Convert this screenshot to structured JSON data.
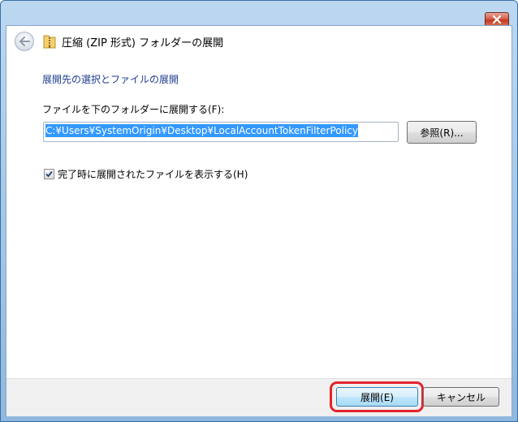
{
  "window": {
    "title": "圧縮 (ZIP 形式) フォルダーの展開",
    "close_icon": "close-icon",
    "back_icon": "back-arrow-icon",
    "folder_icon": "zip-folder-icon"
  },
  "content": {
    "heading": "展開先の選択とファイルの展開",
    "path_label": "ファイルを下のフォルダーに展開する(F):",
    "path_value": "C:¥Users¥SystemOrigin¥Desktop¥LocalAccountTokenFilterPolicy",
    "browse_label": "参照(R)...",
    "checkbox_label": "完了時に展開されたファイルを表示する(H)",
    "checkbox_checked": true
  },
  "footer": {
    "extract_label": "展開(E)",
    "cancel_label": "キャンセル"
  },
  "colors": {
    "heading": "#1e3d8f",
    "selection": "#3399ff",
    "highlight": "#e4232b"
  }
}
